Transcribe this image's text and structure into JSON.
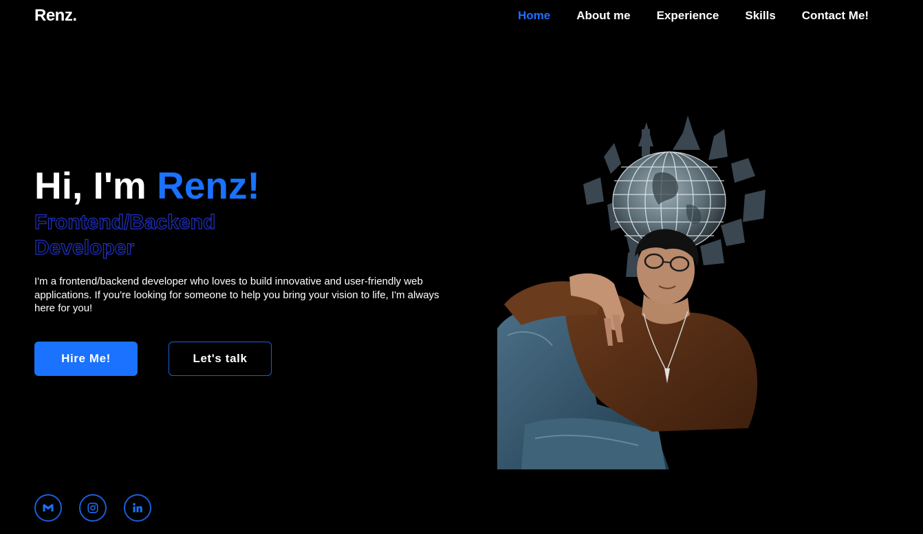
{
  "header": {
    "logo": "Renz.",
    "nav": [
      {
        "label": "Home",
        "active": true
      },
      {
        "label": "About me",
        "active": false
      },
      {
        "label": "Experience",
        "active": false
      },
      {
        "label": "Skills",
        "active": false
      },
      {
        "label": "Contact Me!",
        "active": false
      }
    ]
  },
  "hero": {
    "greeting": "Hi, I'm ",
    "name": "Renz!",
    "role": "Frontend/Backend Developer",
    "description": "I'm a frontend/backend developer who loves to build innovative and user-friendly web applications. If you're looking for someone to help you bring your vision to life, I'm always here for you!",
    "hire_button": "Hire Me!",
    "talk_button": "Let's talk"
  },
  "social": [
    {
      "icon": "gmail-icon"
    },
    {
      "icon": "instagram-icon"
    },
    {
      "icon": "linkedin-icon"
    }
  ],
  "colors": {
    "background": "#000000",
    "accent": "#1a72ff",
    "role_outline": "#2233c8",
    "text": "#ffffff"
  }
}
